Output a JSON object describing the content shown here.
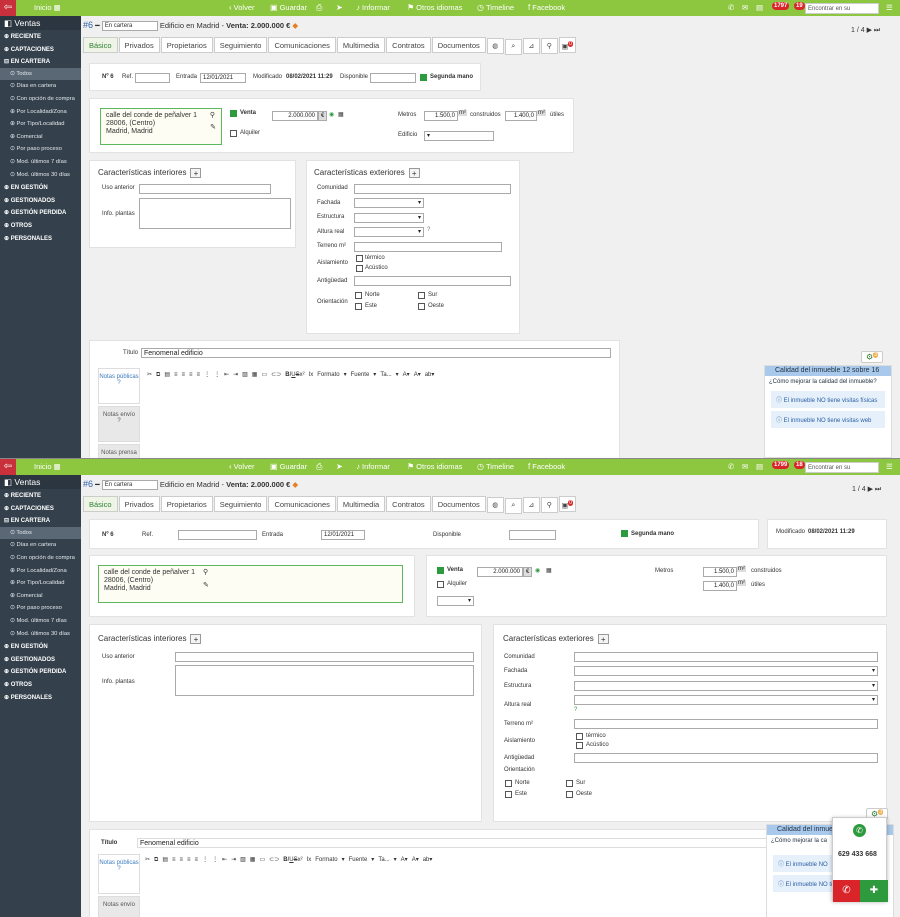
{
  "topbar": {
    "home": "Inicio",
    "volver": "Volver",
    "guardar": "Guardar",
    "informar": "Informar",
    "idiomas": "Otros idiomas",
    "timeline": "Timeline",
    "facebook": "Facebook",
    "search_placeholder": "Encontrar en su inmobiliaria",
    "badge_a": "1797",
    "badge_b": "19",
    "badge_a2": "1799",
    "badge_b2": "18"
  },
  "sidebar": {
    "title": "Ventas",
    "items": [
      "RECIENTE",
      "CAPTACIONES",
      "EN CARTERA",
      "Todos",
      "Días en cartera",
      "Con opción de compra",
      "Por Localidad/Zona",
      "Por Tipo/Localidad",
      "Comercial",
      "Por paso proceso",
      "Mod. últimos 7 días",
      "Mod. últimos 30 días",
      "EN GESTIÓN",
      "GESTIONADOS",
      "GESTIÓN PERDIDA",
      "OTROS",
      "PERSONALES"
    ]
  },
  "header": {
    "num": "#6",
    "status": "En cartera",
    "desc": "Edificio en Madrid -",
    "price": "Venta: 2.000.000 €",
    "pager": "1 / 4"
  },
  "tabs": [
    "Básico",
    "Privados",
    "Propietarios",
    "Seguimiento",
    "Comunicaciones",
    "Multimedia",
    "Contratos",
    "Documentos"
  ],
  "tab_badge": "0",
  "info": {
    "n_label": "Nº 6",
    "ref_label": "Ref.",
    "entrada_label": "Entrada",
    "entrada": "12/01/2021",
    "modificado_label": "Modificado",
    "modificado": "08/02/2021 11:29",
    "disponible_label": "Disponible",
    "segunda": "Segunda mano"
  },
  "address": {
    "line1": "calle del conde de peñalver 1",
    "line2": "28006, (Centro)",
    "line3": "Madrid, Madrid"
  },
  "venta": {
    "label": "Venta",
    "price": "2.000.000",
    "currency": "€",
    "alquiler": "Alquiler",
    "edificio": "Edificio"
  },
  "metros": {
    "label": "Metros",
    "construidos": "1.500,0",
    "construidos_label": "construidos",
    "utiles": "1.400,0",
    "utiles_label": "útiles",
    "unit": "m²"
  },
  "interiores": {
    "title": "Características interiores",
    "uso": "Uso anterior",
    "plantas": "Info. plantas"
  },
  "exteriores": {
    "title": "Características exteriores",
    "comunidad": "Comunidad",
    "fachada": "Fachada",
    "estructura": "Estructura",
    "altura": "Altura real",
    "terreno": "Terreno m²",
    "aislamiento": "Aislamiento",
    "termico": "térmico",
    "acustico": "Acústico",
    "antiguedad": "Antigüedad",
    "orientacion": "Orientación",
    "norte": "Norte",
    "sur": "Sur",
    "este": "Este",
    "oeste": "Oeste"
  },
  "titulo": {
    "label": "Título",
    "value": "Fenomenal edificio"
  },
  "editor": {
    "formato": "Formato",
    "fuente": "Fuente",
    "tam": "Ta..."
  },
  "sidetabs": {
    "notas_publicas": "Notas públicas",
    "notas_envio": "Notas envío",
    "notas_prensa": "Notas prensa"
  },
  "quality": {
    "head": "Calidad del inmueble 12 sobre 16",
    "head2": "Calidad del inmue",
    "question": "¿Cómo mejorar la calidad del inmueble?",
    "question2": "¿Cómo mejorar la ca",
    "item1": "El inmueble NO tiene visitas físicas",
    "item2": "El inmueble NO tiene visitas web",
    "item1b": "El inmueble NO",
    "item2b": "El inmueble NO tiene visitas web",
    "badge": "3"
  },
  "call": {
    "phone": "629 433 668"
  },
  "colors": {
    "green": "#8dc63f",
    "sidebar": "#34404c",
    "red": "#c8303c"
  }
}
